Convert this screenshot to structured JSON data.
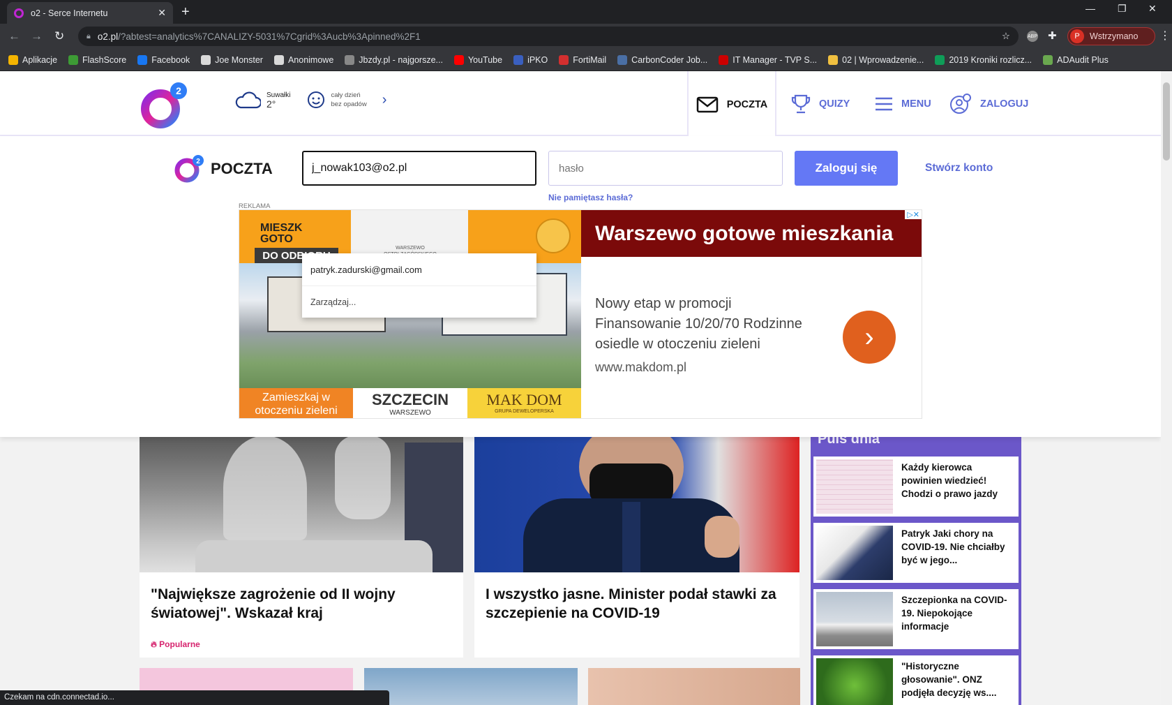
{
  "browser": {
    "tab_title": "o2 - Serce Internetu",
    "url_host": "o2.pl",
    "url_path": "/?abtest=analytics%7CANALIZY-5031%7Cgrid%3Aucb%3Apinned%2F1",
    "profile_initial": "P",
    "profile_label": "Wstrzymano",
    "bookmarks": [
      "Aplikacje",
      "FlashScore",
      "Facebook",
      "Joe Monster",
      "Anonimowe",
      "Jbzdy.pl - najgorsze...",
      "YouTube",
      "iPKO",
      "FortiMail",
      "CarbonCoder Job...",
      "IT Manager - TVP S...",
      "02 | Wprowadzenie...",
      "2019 Kroniki rozlicz...",
      "ADAudit Plus"
    ],
    "bookmark_colors": [
      "#f4b400",
      "#3d9b35",
      "#1877f2",
      "#d9d9d9",
      "#d9d9d9",
      "#888",
      "#ff0000",
      "#3a5fbf",
      "#d32f2f",
      "#4a6fa5",
      "#c00",
      "#f0c040",
      "#0f9d58",
      "#6aa84f"
    ],
    "status_text": "Czekam na cdn.connectad.io..."
  },
  "header": {
    "weather_city": "Suwałki",
    "weather_temp": "2°",
    "weather_desc_1": "cały dzień",
    "weather_desc_2": "bez opadów",
    "menu": [
      "POCZTA",
      "QUIZY",
      "MENU",
      "ZALOGUJ"
    ]
  },
  "login": {
    "brand": "POCZTA",
    "email_value": "j_nowak103@o2.pl",
    "password_placeholder": "hasło",
    "submit_label": "Zaloguj się",
    "create_account": "Stwórz konto",
    "forgot": "Nie pamiętasz hasła?",
    "autocomplete": [
      "patryk.zadurski@gmail.com",
      "Zarządzaj..."
    ]
  },
  "ad": {
    "label": "REKLAMA",
    "headline": "Warszewo gotowe mieszkania",
    "lines": [
      "Nowy etap w promocji",
      "Finansowanie 10/20/70 Rodzinne",
      "osiedle w otoczeniu zieleni"
    ],
    "url": "www.makdom.pl",
    "tag_1": "MIESZK",
    "tag_2": "GOTO",
    "tag_3": "DO ODBIORU",
    "tag_4": "WARSZEWO",
    "tag_5": "OSTOI-ZAGÓRSKIEGO",
    "tile_left": "Zamieszkaj w otoczeniu zieleni",
    "tile_mid_1": "SZCZECIN",
    "tile_mid_2": "WARSZEWO",
    "tile_right_1": "MAK DOM",
    "tile_right_2": "GRUPA DEWELOPERSKA"
  },
  "articles": [
    {
      "title": "\"Największe zagrożenie od II wojny światowej\". Wskazał kraj",
      "badge": "Popularne"
    },
    {
      "title": "I wszystko jasne. Minister podał stawki za szczepienie na COVID-19"
    }
  ],
  "puls": {
    "title": "Puls dnia",
    "items": [
      "Każdy kierowca powinien wiedzieć! Chodzi o prawo jazdy",
      "Patryk Jaki chory na COVID-19. Nie chciałby być w jego...",
      "Szczepionka na COVID-19. Niepokojące informacje",
      "\"Historyczne głosowanie\". ONZ podjęła decyzję ws...."
    ]
  }
}
